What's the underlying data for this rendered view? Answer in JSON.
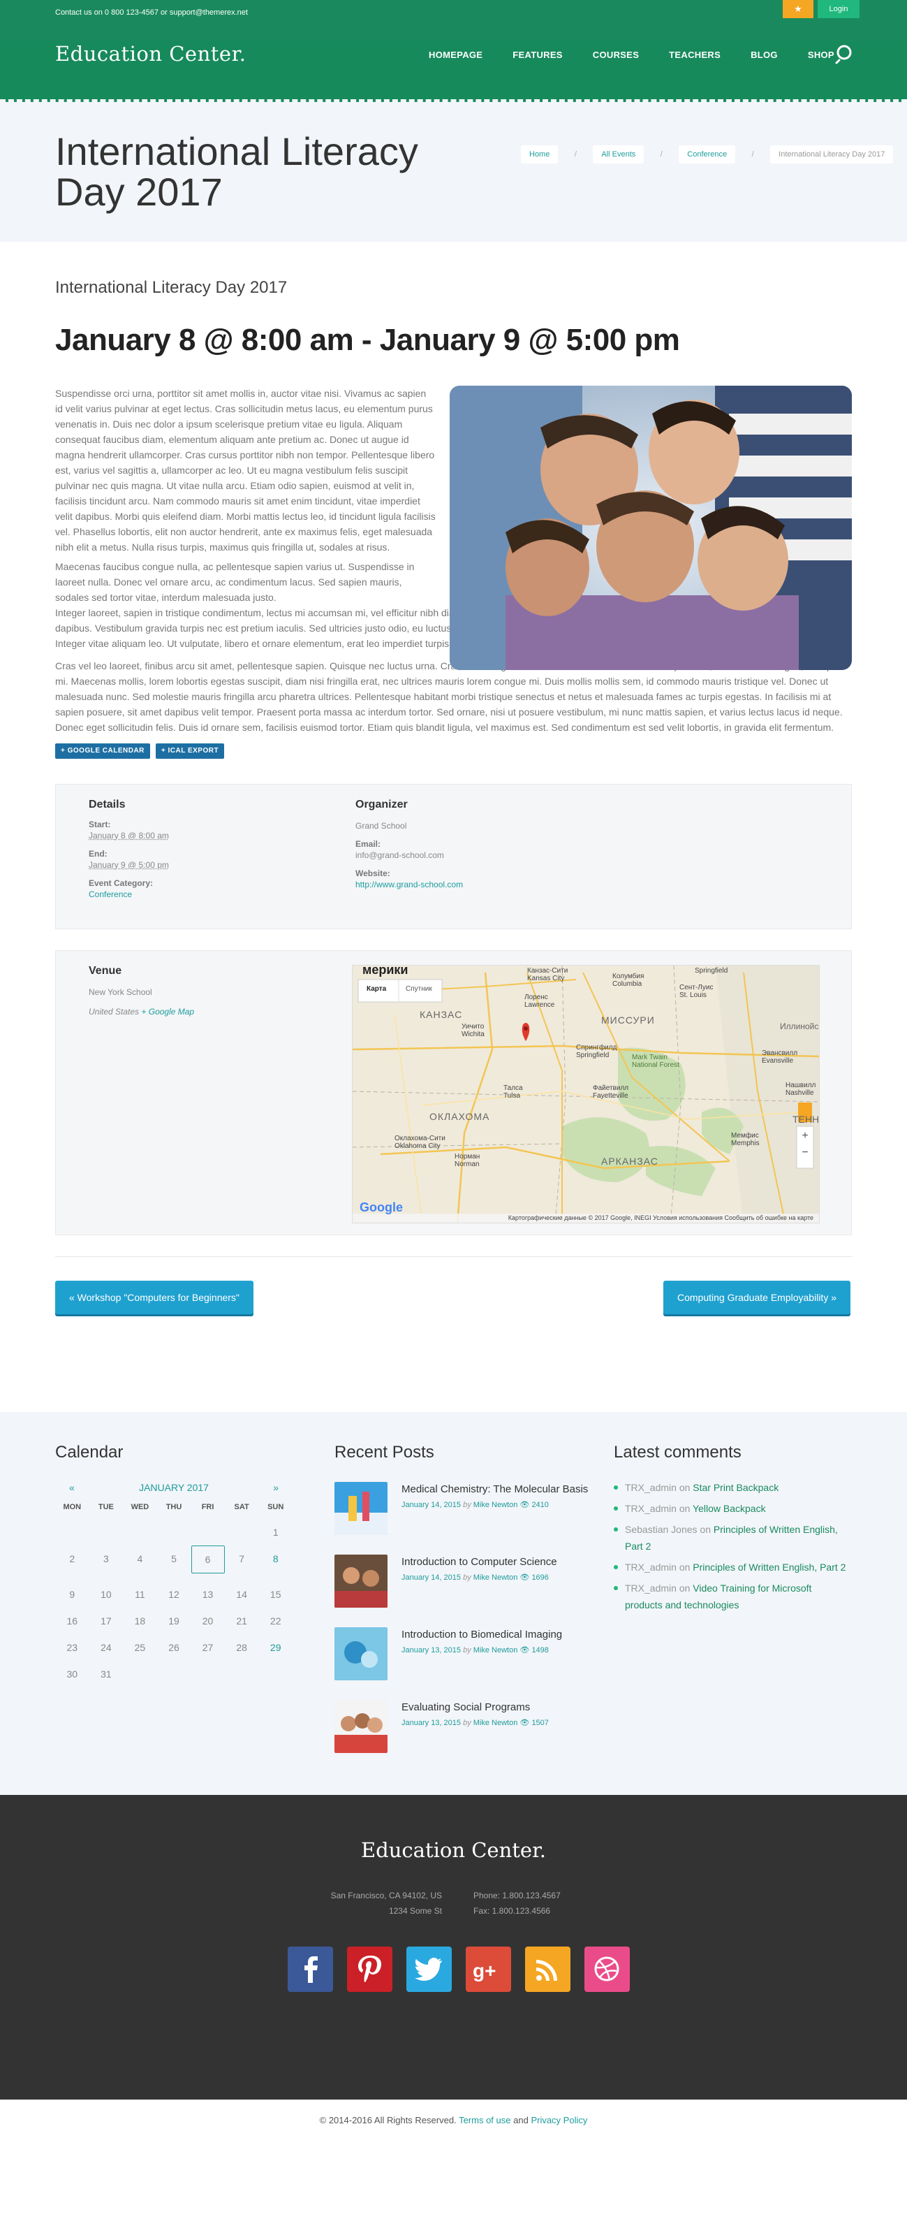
{
  "topbar": {
    "contact_prefix": "Contact us on 0 800 123-4567 or ",
    "email": "support@themerex.net",
    "star_icon": "★",
    "login": "Login"
  },
  "header": {
    "logo": "Education Center.",
    "nav": [
      "HOMEPAGE",
      "FEATURES",
      "COURSES",
      "TEACHERS",
      "BLOG",
      "SHOP"
    ]
  },
  "titlebar": {
    "title": "International Literacy Day 2017",
    "breadcrumbs": [
      "Home",
      "All Events",
      "Conference",
      "International Literacy Day 2017"
    ]
  },
  "event": {
    "subtitle": "International Literacy Day 2017",
    "date_range": "January 8 @ 8:00 am - January 9 @ 5:00 pm",
    "p1": "Suspendisse orci urna, porttitor sit amet mollis in, auctor vitae nisi. Vivamus ac sapien id velit varius pulvinar at eget lectus. Cras sollicitudin metus lacus, eu elementum purus venenatis in. Duis nec dolor a ipsum scelerisque pretium vitae eu ligula. Aliquam consequat faucibus diam, elementum aliquam ante pretium ac. Donec ut augue id magna hendrerit ullamcorper. Cras cursus porttitor nibh non tempor. Pellentesque libero est, varius vel sagittis a, ullamcorper ac leo. Ut eu magna vestibulum felis suscipit pulvinar nec quis magna. Ut vitae nulla arcu. Etiam odio sapien, euismod at velit in, facilisis tincidunt arcu. Nam commodo mauris sit amet enim tincidunt, vitae imperdiet velit dapibus. Morbi quis eleifend diam. Morbi mattis lectus leo, id tincidunt ligula facilisis vel. Phasellus lobortis, elit non auctor hendrerit, ante ex maximus felis, eget malesuada nibh elit a metus. Nulla risus turpis, maximus quis fringilla ut, sodales at risus.",
    "p2": "Maecenas faucibus congue nulla, ac pellentesque sapien varius ut. Suspendisse in laoreet nulla. Donec vel ornare arcu, ac condimentum lacus. Sed sapien mauris, sodales sed tortor vitae, interdum malesuada justo.",
    "p3": "Integer laoreet, sapien in tristique condimentum, lectus mi accumsan mi, vel efficitur nibh diam sit amet nulla. In hac habitasse platea dictumst. Suspendisse sollicitudin vitae sem non dapibus. Vestibulum gravida turpis nec est pretium iaculis. Sed ultricies justo odio, eu luctus eros hendrerit nec. Curabitur magna massa, iaculis in scelerisque a, volutpat ut lectus. Integer vitae aliquam leo. Ut vulputate, libero et ornare elementum, erat leo imperdiet turpis, sed aliquam diam libero ac purus.",
    "p4": "Cras vel leo laoreet, finibus arcu sit amet, pellentesque sapien. Quisque nec luctus urna. Cras eleifend gravida libero a convallis. Etiam ac velit posuere, luctus tellus congue, volutpat mi. Maecenas mollis, lorem lobortis egestas suscipit, diam nisi fringilla erat, nec ultrices mauris lorem congue mi. Duis mollis mollis sem, id commodo mauris tristique vel. Donec ut malesuada nunc. Sed molestie mauris fringilla arcu pharetra ultrices. Pellentesque habitant morbi tristique senectus et netus et malesuada fames ac turpis egestas. In facilisis mi at sapien posuere, sit amet dapibus velit tempor. Praesent porta massa ac interdum tortor. Sed ornare, nisi ut posuere vestibulum, mi nunc mattis sapien, et varius lectus lacus id neque. Donec eget sollicitudin felis. Duis id ornare sem, facilisis euismod tortor. Etiam quis blandit ligula, vel maximus est. Sed condimentum est sed velit lobortis, in gravida elit fermentum.",
    "btn_gcal": "+ GOOGLE CALENDAR",
    "btn_ical": "+ ICAL EXPORT"
  },
  "details": {
    "heading": "Details",
    "start_label": "Start:",
    "start_value": "January 8 @ 8:00 am",
    "end_label": "End:",
    "end_value": "January 9 @ 5:00 pm",
    "category_label": "Event Category:",
    "category_value": "Conference"
  },
  "organizer": {
    "heading": "Organizer",
    "name": "Grand School",
    "email_label": "Email:",
    "email": "info@grand-school.com",
    "website_label": "Website:",
    "website": "http://www.grand-school.com"
  },
  "venue": {
    "heading": "Venue",
    "name": "New York School",
    "country": "United States",
    "map_link": "+ Google Map",
    "map_tab_map": "Карта",
    "map_tab_sat": "Спутник",
    "map_title": "мерики",
    "map_footer": "Картографические данные © 2017 Google, INEGI   Условия использования   Сообщить об ошибке на карте",
    "map_brand": "Google",
    "map_labels": [
      "Канзас-Сити Kansas City",
      "Колумбия Columbia",
      "Springfield",
      "Сент-Луис St. Louis",
      "Лоренс Lawrence",
      "КАНЗАС",
      "МИССУРИ",
      "Иллинойс",
      "Уичито Wichita",
      "Спрингфилд Springfield",
      "Mark Twain National Forest",
      "Эвансвилл Evansville",
      "Талса Tulsa",
      "Файетвилл Fayetteville",
      "Нашвилл Nashville",
      "ОКЛАХОМА",
      "Оклахома-Сити Oklahoma City",
      "Норман Norman",
      "АРКАНЗАС",
      "Мемфис Memphis",
      "ТЕННЕ"
    ]
  },
  "post_nav": {
    "prev": "« Workshop \"Computers for Beginners\"",
    "next": "Computing Graduate Employability »"
  },
  "calendar": {
    "heading": "Calendar",
    "prev": "«",
    "month": "JANUARY 2017",
    "next": "»",
    "dow": [
      "MON",
      "TUE",
      "WED",
      "THU",
      "FRI",
      "SAT",
      "SUN"
    ],
    "rows": [
      [
        "",
        "",
        "",
        "",
        "",
        "",
        "1"
      ],
      [
        "2",
        "3",
        "4",
        "5",
        "6",
        "7",
        "8"
      ],
      [
        "9",
        "10",
        "11",
        "12",
        "13",
        "14",
        "15"
      ],
      [
        "16",
        "17",
        "18",
        "19",
        "20",
        "21",
        "22"
      ],
      [
        "23",
        "24",
        "25",
        "26",
        "27",
        "28",
        "29"
      ],
      [
        "30",
        "31",
        "",
        "",
        "",
        "",
        ""
      ]
    ],
    "today": "6",
    "event_days": [
      "8",
      "29"
    ]
  },
  "recent_posts": {
    "heading": "Recent Posts",
    "items": [
      {
        "title": "Medical Chemistry: The Molecular Basis",
        "date": "January 14, 2015",
        "by": "by",
        "author": "Mike Newton",
        "views": "2410"
      },
      {
        "title": "Introduction to Computer Science",
        "date": "January 14, 2015",
        "by": "by",
        "author": "Mike Newton",
        "views": "1696"
      },
      {
        "title": "Introduction to Biomedical Imaging",
        "date": "January 13, 2015",
        "by": "by",
        "author": "Mike Newton",
        "views": "1498"
      },
      {
        "title": "Evaluating Social Programs",
        "date": "January 13, 2015",
        "by": "by",
        "author": "Mike Newton",
        "views": "1507"
      }
    ]
  },
  "latest_comments": {
    "heading": "Latest comments",
    "on": "on",
    "items": [
      {
        "author": "TRX_admin",
        "post": "Star Print Backpack"
      },
      {
        "author": "TRX_admin",
        "post": "Yellow Backpack"
      },
      {
        "author": "Sebastian Jones",
        "post": "Principles of Written English, Part 2"
      },
      {
        "author": "TRX_admin",
        "post": "Principles of Written English, Part 2"
      },
      {
        "author": "TRX_admin",
        "post": "Video Training for Microsoft products and technologies"
      }
    ]
  },
  "footer": {
    "logo": "Education Center.",
    "address1": "San Francisco, CA 94102, US",
    "address2": "1234 Some St",
    "phone": "Phone: 1.800.123.4567",
    "fax": "Fax: 1.800.123.4566",
    "socials": [
      {
        "name": "facebook-icon",
        "color": "#3b5998"
      },
      {
        "name": "pinterest-icon",
        "color": "#cb2027"
      },
      {
        "name": "twitter-icon",
        "color": "#2aa9e0"
      },
      {
        "name": "google-plus-icon",
        "color": "#dd4b39"
      },
      {
        "name": "rss-icon",
        "color": "#f5a623"
      },
      {
        "name": "dribbble-icon",
        "color": "#ea4c89"
      }
    ],
    "copyright_prefix": "© 2014-2016 All Rights Reserved.",
    "terms": "Terms of use",
    "and": "and",
    "privacy": "Privacy Policy"
  }
}
